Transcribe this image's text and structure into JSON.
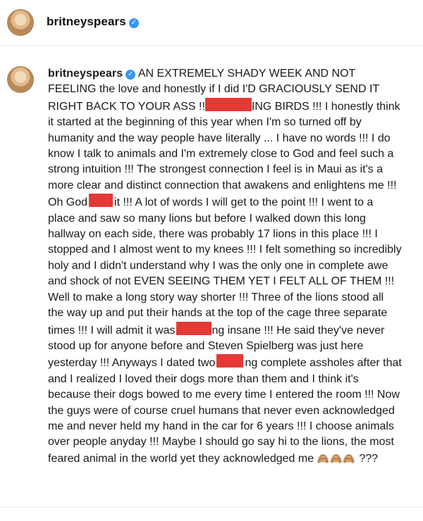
{
  "header": {
    "username": "britneyspears",
    "verified_icon": "verified-badge-icon"
  },
  "post": {
    "username": "britneyspears",
    "segments": [
      "AN EXTREMELY SHADY WEEK AND NOT FEELING the love and honestly if I did I'D GRACIOUSLY SEND IT RIGHT BACK TO YOUR ASS !!",
      "ING BIRDS !!! I honestly think it started at the beginning of this year when I'm so turned off by humanity and the way people have literally ... I have no words !!! I do know I talk to animals and I'm extremely close to God and feel such a strong intuition !!! The strongest connection I feel is in Maui as it's a more clear and distinct connection that awakens and enlightens me !!! Oh God",
      "it !!! A lot of words I will get to the point !!! I went to a place and saw so many lions but before I walked down this long hallway on each side, there was probably 17 lions in this place !!! I stopped and I almost went to my knees !!! I felt something so incredibly holy and I didn't understand why I was the only one in complete awe and shock of not EVEN SEEING THEM YET I FELT ALL OF THEM !!! Well to make a long story way shorter !!! Three of the lions stood all the way up and put their hands at the top of the cage three separate times !!! I will admit it was",
      "ng insane !!! He said they've never stood up for anyone before and Steven Spielberg was just here yesterday !!! Anyways I dated two",
      "ng complete assholes after that and I realized I loved their dogs more than them and I think it's because their dogs bowed to me every time I entered the room !!! Now the guys were of course cruel humans that never even acknowledged me and never held my hand in the car for 6 years !!! I choose animals over people anyday !!! Maybe I should go say hi to the lions, the most feared animal in the world yet they acknowledged me",
      "???"
    ],
    "emoji": "🙈🙈🙈",
    "redaction_color": "#e53935"
  }
}
